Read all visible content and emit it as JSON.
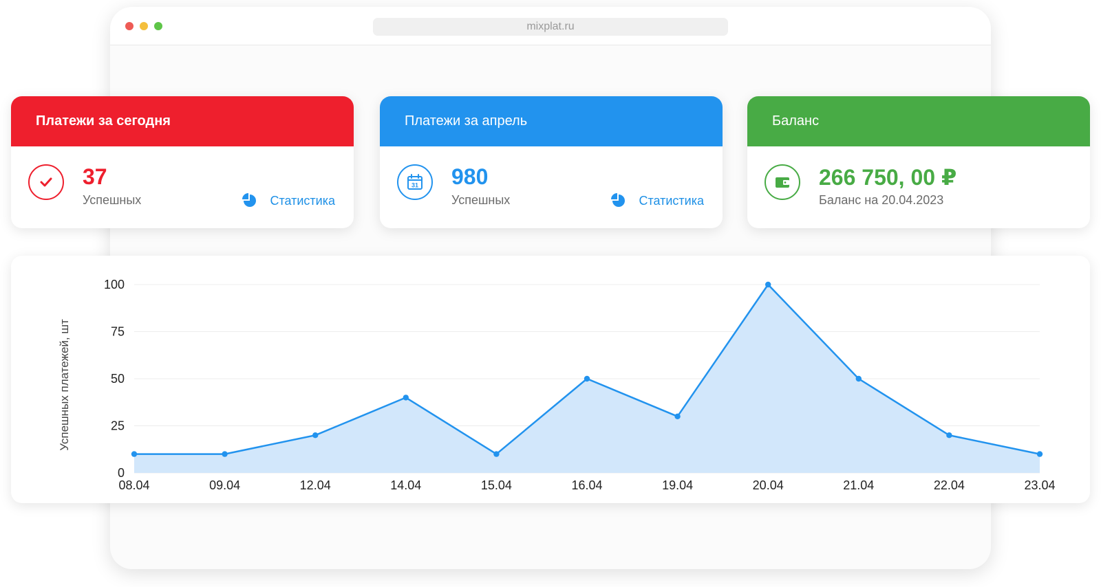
{
  "browser": {
    "url": "mixplat.ru"
  },
  "cards": {
    "today": {
      "title": "Платежи за сегодня",
      "value": "37",
      "sub": "Успешных",
      "link": "Статистика",
      "color": "#ee1f2d",
      "icon": "checkmark-circle-icon"
    },
    "month": {
      "title": "Платежи за апрель",
      "value": "980",
      "sub": "Успешных",
      "link": "Статистика",
      "color": "#2293ee",
      "icon": "calendar-icon"
    },
    "balance": {
      "title": "Баланс",
      "value": "266 750, 00 ₽",
      "sub": "Баланс на 20.04.2023",
      "color": "#48ab45",
      "icon": "wallet-icon"
    }
  },
  "link_icon": "pie-chart-icon",
  "chart_data": {
    "type": "area",
    "x": [
      "08.04",
      "09.04",
      "12.04",
      "14.04",
      "15.04",
      "16.04",
      "19.04",
      "20.04",
      "21.04",
      "22.04",
      "23.04"
    ],
    "series": [
      {
        "values": [
          10,
          10,
          20,
          40,
          10,
          50,
          30,
          100,
          50,
          20,
          10
        ]
      }
    ],
    "ylabel": "Успешных платежей, шт",
    "xlabel": "",
    "yticks": [
      0,
      25,
      50,
      75,
      100
    ],
    "ylim": [
      0,
      100
    ],
    "grid": true,
    "line_color": "#2293ee",
    "fill_color": "#d2e7fb"
  }
}
